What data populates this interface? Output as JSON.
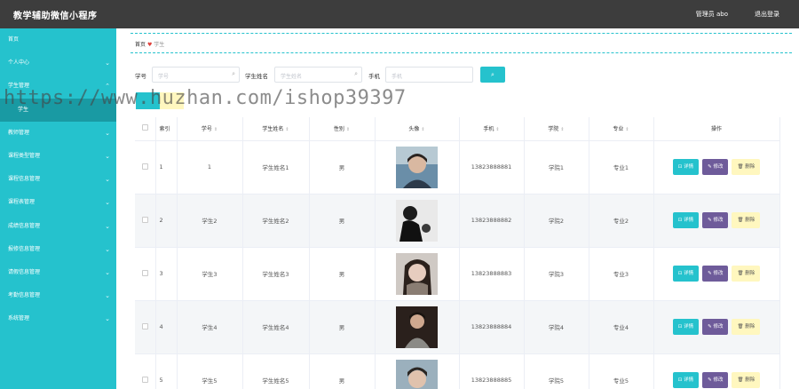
{
  "header": {
    "title": "教学辅助微信小程序",
    "admin": "管理员 abo",
    "logout": "退出登录"
  },
  "sidebar": {
    "items": [
      {
        "label": "首页",
        "chevron": false
      },
      {
        "label": "个人中心",
        "chevron": true
      },
      {
        "label": "学生管理",
        "chevron": true
      },
      {
        "label": "学生",
        "chevron": false,
        "sub": true
      },
      {
        "label": "教师管理",
        "chevron": true
      },
      {
        "label": "课程类型管理",
        "chevron": true
      },
      {
        "label": "课程信息管理",
        "chevron": true
      },
      {
        "label": "课程表管理",
        "chevron": true
      },
      {
        "label": "成绩信息管理",
        "chevron": true
      },
      {
        "label": "报修信息管理",
        "chevron": true
      },
      {
        "label": "请假信息管理",
        "chevron": true
      },
      {
        "label": "考勤信息管理",
        "chevron": true
      },
      {
        "label": "系统管理",
        "chevron": true
      }
    ]
  },
  "breadcrumb": {
    "home": "首页",
    "sep": "♥",
    "current": "学生"
  },
  "search": {
    "no_label": "学号",
    "no_placeholder": "学号",
    "name_label": "学生姓名",
    "name_placeholder": "学生姓名",
    "phone_label": "手机",
    "phone_placeholder": "手机",
    "button_icon": "search-icon"
  },
  "watermark": "https://www.huzhan.com/ishop39397",
  "table": {
    "headers": [
      "索引",
      "学号",
      "学生姓名",
      "性别",
      "头像",
      "手机",
      "学院",
      "专业",
      "操作"
    ],
    "rows": [
      {
        "idx": "1",
        "no": "1",
        "name": "学生姓名1",
        "sex": "男",
        "phone": "13823888881",
        "college": "学院1",
        "major": "专业1"
      },
      {
        "idx": "2",
        "no": "学生2",
        "name": "学生姓名2",
        "sex": "男",
        "phone": "13823888882",
        "college": "学院2",
        "major": "专业2"
      },
      {
        "idx": "3",
        "no": "学生3",
        "name": "学生姓名3",
        "sex": "男",
        "phone": "13823888883",
        "college": "学院3",
        "major": "专业3"
      },
      {
        "idx": "4",
        "no": "学生4",
        "name": "学生姓名4",
        "sex": "男",
        "phone": "13823888884",
        "college": "学院4",
        "major": "专业4"
      },
      {
        "idx": "5",
        "no": "学生5",
        "name": "学生姓名5",
        "sex": "男",
        "phone": "13823888885",
        "college": "学院5",
        "major": "专业5"
      }
    ],
    "ops": {
      "detail": "⊡ 详情",
      "edit": "✎ 修改",
      "delete": "🗑 删除"
    }
  },
  "colors": {
    "accent": "#25c2cd",
    "edit": "#6e5b9a",
    "delete": "#fff7bf",
    "topbar": "#3d3d3d"
  }
}
